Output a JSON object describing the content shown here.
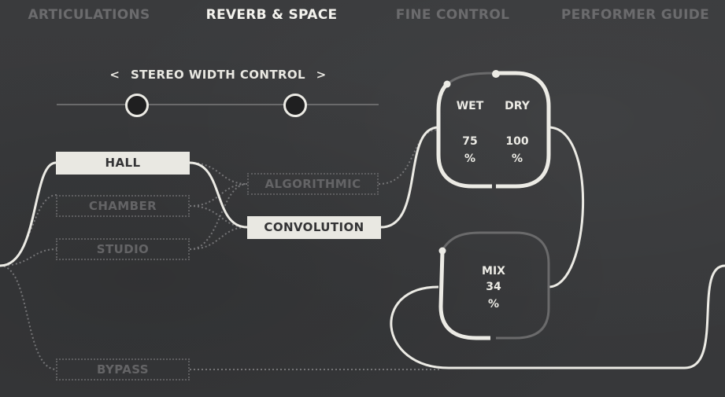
{
  "tabs": [
    {
      "label": "ARTICULATIONS",
      "active": false
    },
    {
      "label": "REVERB & SPACE",
      "active": true
    },
    {
      "label": "FINE CONTROL",
      "active": false
    },
    {
      "label": "PERFORMER GUIDE",
      "active": false
    }
  ],
  "stereo_width": {
    "label": "STEREO WIDTH CONTROL",
    "prev_arrow": "<",
    "next_arrow": ">",
    "left_knob_position": 0.25,
    "right_knob_position": 0.74
  },
  "room_types": [
    {
      "label": "HALL",
      "selected": true
    },
    {
      "label": "CHAMBER",
      "selected": false
    },
    {
      "label": "STUDIO",
      "selected": false
    },
    {
      "label": "BYPASS",
      "selected": false
    }
  ],
  "engines": [
    {
      "label": "ALGORITHMIC",
      "selected": false
    },
    {
      "label": "CONVOLUTION",
      "selected": true
    }
  ],
  "wet_dry": {
    "wet_label": "WET",
    "dry_label": "DRY",
    "wet_value": "75",
    "dry_value": "100",
    "unit": "%"
  },
  "mix": {
    "label": "MIX",
    "value": "34",
    "unit": "%"
  },
  "colors": {
    "background": "#393a3c",
    "active": "#ecebe5",
    "inactive": "#646466",
    "track": "#6a6a6b"
  }
}
